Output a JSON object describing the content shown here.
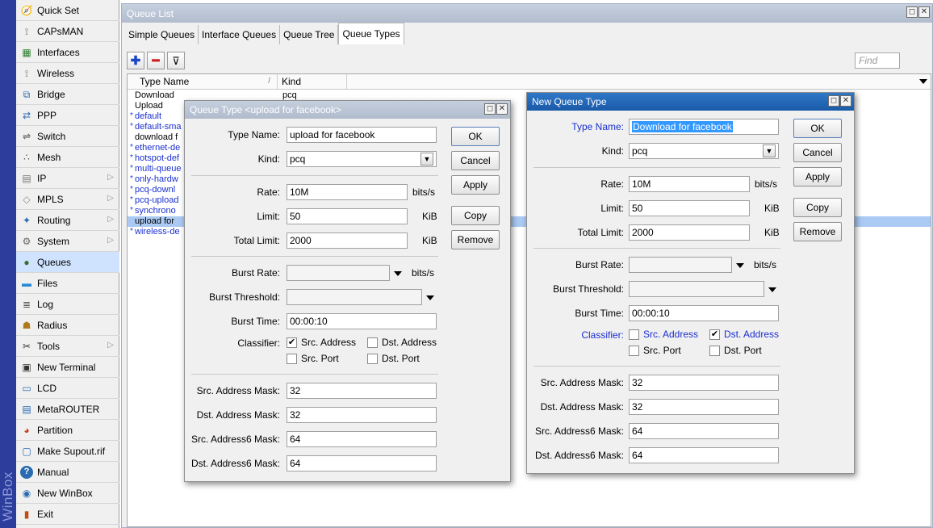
{
  "app": {
    "brand": "WinBox"
  },
  "sidebar": {
    "items": [
      {
        "label": "Quick Set",
        "icon": "quick-set-icon"
      },
      {
        "label": "CAPsMAN",
        "icon": "antenna-icon"
      },
      {
        "label": "Interfaces",
        "icon": "interfaces-icon"
      },
      {
        "label": "Wireless",
        "icon": "antenna-icon"
      },
      {
        "label": "Bridge",
        "icon": "bridge-icon"
      },
      {
        "label": "PPP",
        "icon": "ppp-icon"
      },
      {
        "label": "Switch",
        "icon": "switch-icon"
      },
      {
        "label": "Mesh",
        "icon": "mesh-icon"
      },
      {
        "label": "IP",
        "icon": "ip-icon",
        "has_submenu": true
      },
      {
        "label": "MPLS",
        "icon": "mpls-icon",
        "has_submenu": true
      },
      {
        "label": "Routing",
        "icon": "routing-icon",
        "has_submenu": true
      },
      {
        "label": "System",
        "icon": "gear-icon",
        "has_submenu": true
      },
      {
        "label": "Queues",
        "icon": "queues-icon"
      },
      {
        "label": "Files",
        "icon": "folder-icon"
      },
      {
        "label": "Log",
        "icon": "log-icon"
      },
      {
        "label": "Radius",
        "icon": "radius-icon"
      },
      {
        "label": "Tools",
        "icon": "tools-icon",
        "has_submenu": true
      },
      {
        "label": "New Terminal",
        "icon": "terminal-icon"
      },
      {
        "label": "LCD",
        "icon": "lcd-icon"
      },
      {
        "label": "MetaROUTER",
        "icon": "metarouter-icon"
      },
      {
        "label": "Partition",
        "icon": "partition-icon"
      },
      {
        "label": "Make Supout.rif",
        "icon": "file-icon"
      },
      {
        "label": "Manual",
        "icon": "help-icon"
      },
      {
        "label": "New WinBox",
        "icon": "winbox-icon"
      },
      {
        "label": "Exit",
        "icon": "exit-icon"
      }
    ]
  },
  "queue_list": {
    "title": "Queue List",
    "window_buttons": [
      "◻",
      "✕"
    ],
    "tabs": [
      {
        "label": "Simple Queues"
      },
      {
        "label": "Interface Queues"
      },
      {
        "label": "Queue Tree"
      },
      {
        "label": "Queue Types",
        "active": true
      }
    ],
    "toolbar": {
      "add": "✚",
      "remove": "━",
      "filter": "⊽"
    },
    "find_placeholder": "Find",
    "columns": {
      "name": "Type Name",
      "kind": "Kind",
      "sort_indicator": "/"
    },
    "rows": [
      {
        "name": "Download",
        "kind": "pcq",
        "mark": "",
        "blue": false
      },
      {
        "name": "Upload",
        "kind": "",
        "mark": "",
        "blue": false
      },
      {
        "name": "default",
        "kind": "",
        "mark": "*",
        "blue": true
      },
      {
        "name": "default-sma",
        "kind": "",
        "mark": "*",
        "blue": true
      },
      {
        "name": "download f",
        "kind": "",
        "mark": "",
        "blue": false
      },
      {
        "name": "ethernet-de",
        "kind": "",
        "mark": "*",
        "blue": true
      },
      {
        "name": "hotspot-def",
        "kind": "",
        "mark": "*",
        "blue": true
      },
      {
        "name": "multi-queue",
        "kind": "",
        "mark": "*",
        "blue": true
      },
      {
        "name": "only-hardw",
        "kind": "",
        "mark": "*",
        "blue": true
      },
      {
        "name": "pcq-downl",
        "kind": "",
        "mark": "*",
        "blue": true
      },
      {
        "name": "pcq-upload",
        "kind": "",
        "mark": "*",
        "blue": true
      },
      {
        "name": "synchrono",
        "kind": "",
        "mark": "*",
        "blue": true
      },
      {
        "name": "upload for",
        "kind": "",
        "mark": "",
        "blue": false,
        "selected": true
      },
      {
        "name": "wireless-de",
        "kind": "",
        "mark": "*",
        "blue": true
      }
    ]
  },
  "dialog1": {
    "title": "Queue Type <upload for facebook>",
    "type_name_label": "Type Name:",
    "type_name": "upload for facebook",
    "kind_label": "Kind:",
    "kind": "pcq",
    "rate_label": "Rate:",
    "rate": "10M",
    "rate_unit": "bits/s",
    "limit_label": "Limit:",
    "limit": "50",
    "limit_unit": "KiB",
    "total_limit_label": "Total Limit:",
    "total_limit": "2000",
    "total_limit_unit": "KiB",
    "burst_rate_label": "Burst Rate:",
    "burst_rate": "",
    "burst_rate_unit": "bits/s",
    "burst_threshold_label": "Burst Threshold:",
    "burst_threshold": "",
    "burst_time_label": "Burst Time:",
    "burst_time": "00:00:10",
    "classifier_label": "Classifier:",
    "classifier": {
      "src_address": {
        "label": "Src. Address",
        "checked": true
      },
      "dst_address": {
        "label": "Dst. Address",
        "checked": false
      },
      "src_port": {
        "label": "Src. Port",
        "checked": false
      },
      "dst_port": {
        "label": "Dst. Port",
        "checked": false
      }
    },
    "src_mask_label": "Src. Address Mask:",
    "src_mask": "32",
    "dst_mask_label": "Dst. Address Mask:",
    "dst_mask": "32",
    "src6_mask_label": "Src. Address6 Mask:",
    "src6_mask": "64",
    "dst6_mask_label": "Dst. Address6 Mask:",
    "dst6_mask": "64",
    "buttons": {
      "ok": "OK",
      "cancel": "Cancel",
      "apply": "Apply",
      "copy": "Copy",
      "remove": "Remove"
    }
  },
  "dialog2": {
    "title": "New Queue Type",
    "type_name_label": "Type Name:",
    "type_name": "Download for facebook",
    "kind_label": "Kind:",
    "kind": "pcq",
    "rate_label": "Rate:",
    "rate": "10M",
    "rate_unit": "bits/s",
    "limit_label": "Limit:",
    "limit": "50",
    "limit_unit": "KiB",
    "total_limit_label": "Total Limit:",
    "total_limit": "2000",
    "total_limit_unit": "KiB",
    "burst_rate_label": "Burst Rate:",
    "burst_rate": "",
    "burst_rate_unit": "bits/s",
    "burst_threshold_label": "Burst Threshold:",
    "burst_threshold": "",
    "burst_time_label": "Burst Time:",
    "burst_time": "00:00:10",
    "classifier_label": "Classifier:",
    "classifier": {
      "src_address": {
        "label": "Src. Address",
        "checked": false
      },
      "dst_address": {
        "label": "Dst. Address",
        "checked": true
      },
      "src_port": {
        "label": "Src. Port",
        "checked": false
      },
      "dst_port": {
        "label": "Dst. Port",
        "checked": false
      }
    },
    "src_mask_label": "Src. Address Mask:",
    "src_mask": "32",
    "dst_mask_label": "Dst. Address Mask:",
    "dst_mask": "32",
    "src6_mask_label": "Src. Address6 Mask:",
    "src6_mask": "64",
    "dst6_mask_label": "Dst. Address6 Mask:",
    "dst6_mask": "64",
    "buttons": {
      "ok": "OK",
      "cancel": "Cancel",
      "apply": "Apply",
      "copy": "Copy",
      "remove": "Remove"
    }
  },
  "colors": {
    "brand_stripe": "#2d3d9c",
    "inactive_title": "#b9c3d3",
    "active_title": "#1f65b5",
    "selection": "#aac9f3",
    "link_blue": "#1a2fd0"
  }
}
